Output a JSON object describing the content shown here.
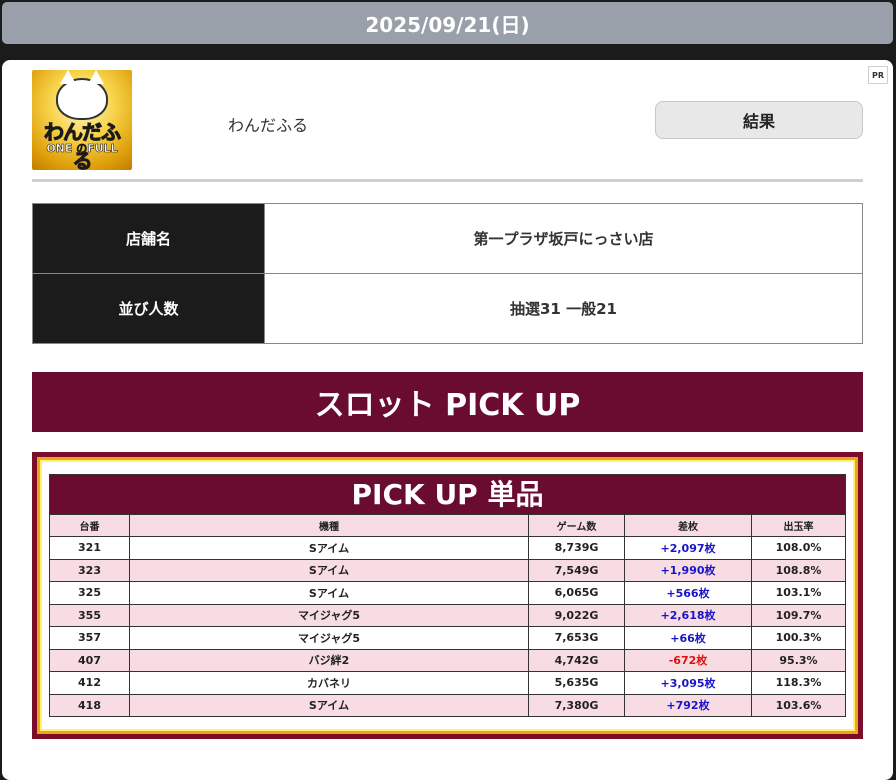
{
  "header": {
    "date": "2025/09/21(日)"
  },
  "machine": {
    "name": "わんだふる",
    "logo_text": "わんだふる",
    "logo_sub": "ONE のFULL",
    "result_label": "結果",
    "pr_label": "PR"
  },
  "store_info": {
    "store_label": "店舗名",
    "store_value": "第一プラザ坂戸にっさい店",
    "queue_label": "並び人数",
    "queue_value": "抽選31 一般21"
  },
  "pickup": {
    "banner": "スロット PICK UP",
    "table_title": "PICK UP 単品",
    "columns": [
      "台番",
      "機種",
      "ゲーム数",
      "差枚",
      "出玉率"
    ],
    "rows": [
      {
        "no": "321",
        "model": "Sアイム",
        "games": "8,739G",
        "diff": "+2,097枚",
        "rate": "108.0%"
      },
      {
        "no": "323",
        "model": "Sアイム",
        "games": "7,549G",
        "diff": "+1,990枚",
        "rate": "108.8%"
      },
      {
        "no": "325",
        "model": "Sアイム",
        "games": "6,065G",
        "diff": "+566枚",
        "rate": "103.1%"
      },
      {
        "no": "355",
        "model": "マイジャグ5",
        "games": "9,022G",
        "diff": "+2,618枚",
        "rate": "109.7%"
      },
      {
        "no": "357",
        "model": "マイジャグ5",
        "games": "7,653G",
        "diff": "+66枚",
        "rate": "100.3%"
      },
      {
        "no": "407",
        "model": "バジ絆2",
        "games": "4,742G",
        "diff": "-672枚",
        "rate": "95.3%"
      },
      {
        "no": "412",
        "model": "カバネリ",
        "games": "5,635G",
        "diff": "+3,095枚",
        "rate": "118.3%"
      },
      {
        "no": "418",
        "model": "Sアイム",
        "games": "7,380G",
        "diff": "+792枚",
        "rate": "103.6%"
      }
    ]
  },
  "colors": {
    "date_bar": "#9aa0aa",
    "banner": "#6a0b30",
    "row_alt": "#f8dce3",
    "positive": "#1a14c8",
    "negative": "#e01010"
  }
}
